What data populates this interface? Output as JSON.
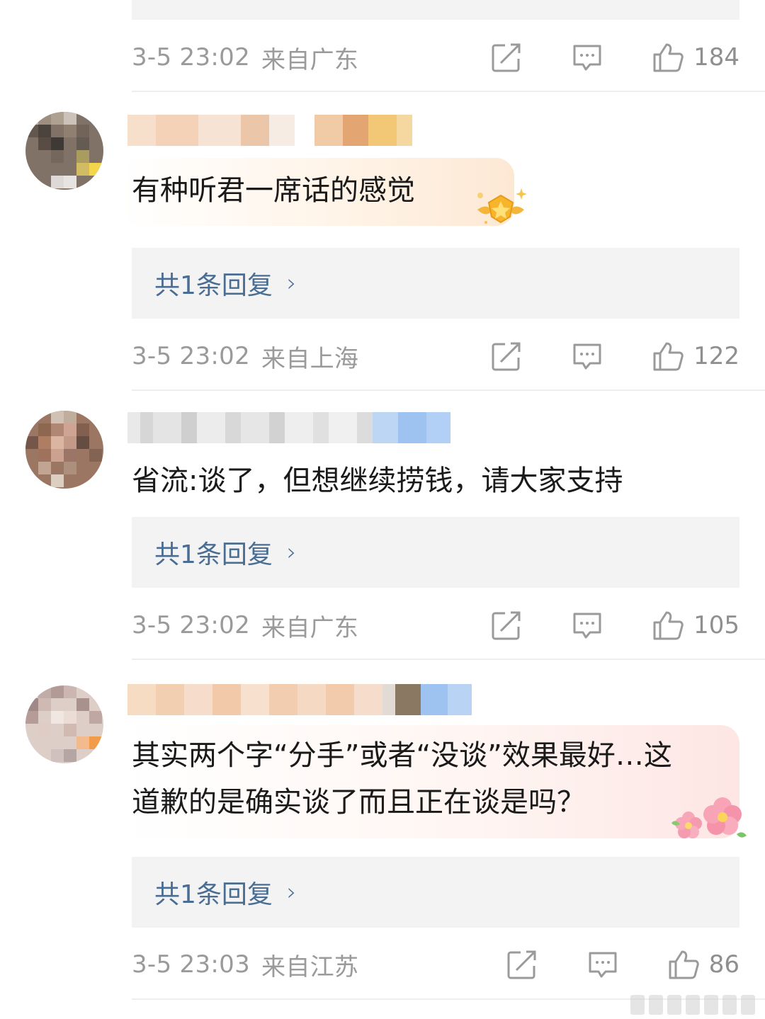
{
  "comments": [
    {
      "time": "3-5 23:02",
      "location": "来自广东",
      "likes": "184"
    },
    {
      "text_lines": [
        "有种听君一席话的感觉"
      ],
      "reply_label": "共1条回复",
      "time": "3-5 23:02",
      "location": "来自上海",
      "likes": "122",
      "badge": "gold-star-badge"
    },
    {
      "text_lines": [
        "省流:谈了，但想继续捞钱，请大家支持"
      ],
      "reply_label": "共1条回复",
      "time": "3-5 23:02",
      "location": "来自广东",
      "likes": "105"
    },
    {
      "text_lines": [
        "其实两个字“分手”或者“没谈”效果最好…这",
        "道歉的是确实谈了而且正在谈是吗？"
      ],
      "reply_label": "共1条回复",
      "time": "3-5 23:03",
      "location": "来自江苏",
      "likes": "86",
      "badge": "cherry-blossom-badge"
    }
  ],
  "icons": {
    "repost": "repost-icon",
    "comment": "comment-icon",
    "like": "thumbs-up-icon",
    "reply_chevron": "›"
  },
  "colors": {
    "meta": "#9a9a9a",
    "reply_link": "#4a6d94",
    "reply_box": "#f3f3f3",
    "divider": "#eeeeee"
  }
}
